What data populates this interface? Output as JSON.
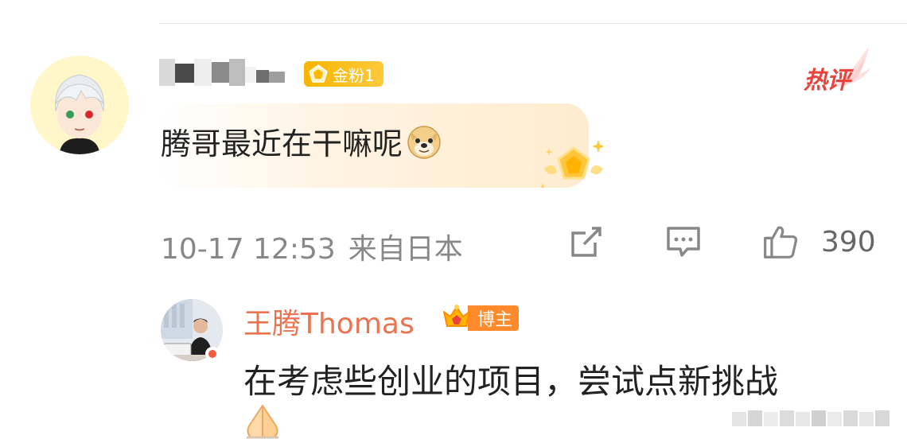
{
  "comment": {
    "fan_badge": "金粉1",
    "hot_tag": "热评",
    "text": "腾哥最近在干嘛呢",
    "time": "10-17 12:53",
    "location": "来自日本",
    "like_count": "390"
  },
  "reply": {
    "author": "王腾Thomas",
    "host_badge": "博主",
    "text": "在考虑些创业的项目，尝试点新挑战"
  },
  "colors": {
    "reply_name": "#eb7350",
    "hot": "#e8443f",
    "fan_badge": "#f7b500",
    "host_badge": "#ff8a2b"
  },
  "icons": [
    "share-icon",
    "comment-icon",
    "like-icon",
    "doge-emoji-icon",
    "folded-hands-emoji-icon"
  ]
}
